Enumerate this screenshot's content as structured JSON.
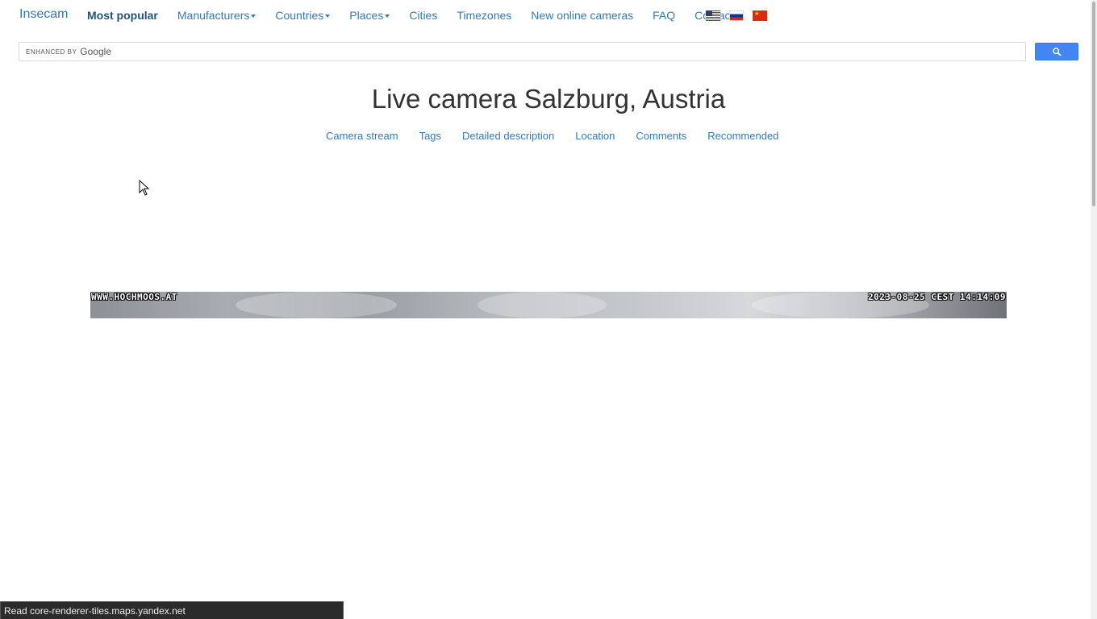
{
  "nav": {
    "brand": "Insecam",
    "most_popular": "Most popular",
    "manufacturers": "Manufacturers",
    "countries": "Countries",
    "places": "Places",
    "cities": "Cities",
    "timezones": "Timezones",
    "new_cameras": "New online cameras",
    "faq": "FAQ",
    "contacts": "Contacts",
    "flags": [
      "us-flag-icon",
      "ru-flag-icon",
      "cn-flag-icon"
    ]
  },
  "search": {
    "enhanced_by": "ENHANCED BY",
    "google": "Google",
    "button_icon": "search-icon"
  },
  "page": {
    "title": "Live camera Salzburg, Austria"
  },
  "subnav": {
    "camera_stream": "Camera stream",
    "tags": "Tags",
    "detailed_description": "Detailed description",
    "location": "Location",
    "comments": "Comments",
    "recommended": "Recommended"
  },
  "camera": {
    "watermark": "WWW.HOCHMOOS.AT",
    "timestamp": "2023-08-25 CEST 14:14:09"
  },
  "statusbar": {
    "text": "Read core-renderer-tiles.maps.yandex.net"
  },
  "colors": {
    "link": "#337ab7",
    "search_button": "#4285f4",
    "status_bg": "#2b2b2b"
  }
}
